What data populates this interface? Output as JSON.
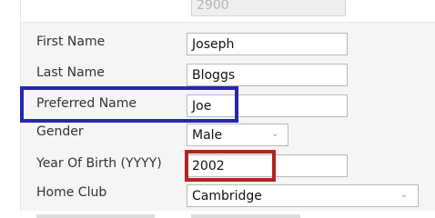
{
  "form": {
    "fields": [
      {
        "key": "reference",
        "label": "",
        "value": "2900"
      },
      {
        "key": "first_name",
        "label": "First Name",
        "value": "Joseph"
      },
      {
        "key": "last_name",
        "label": "Last Name",
        "value": "Bloggs"
      },
      {
        "key": "preferred_name",
        "label": "Preferred Name",
        "value": "Joe"
      },
      {
        "key": "gender",
        "label": "Gender",
        "value": "Male"
      },
      {
        "key": "year_of_birth",
        "label": "Year Of Birth (YYYY)",
        "value": "2002"
      },
      {
        "key": "home_club",
        "label": "Home Club",
        "value": "Cambridge"
      }
    ],
    "dropdown_icon": "chevron-down",
    "annotations": {
      "preferred_name_color": "#2626b5",
      "year_of_birth_color": "#b52323"
    }
  }
}
